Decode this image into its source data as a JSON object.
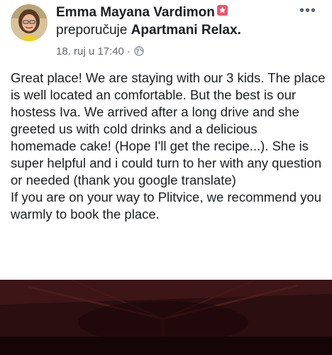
{
  "post": {
    "author": "Emma Mayana Vardimon",
    "action": "preporučuje",
    "page_name": "Apartmani Relax.",
    "date": "18. ruj u 17:40",
    "separator": "·",
    "privacy_icon": "globe-icon",
    "more_icon": "more-options-icon",
    "badge_icon": "recommendation-badge-icon",
    "text": "Great place! We are staying with our 3 kids. The place is well located an comfortable. But the best is our hostess Iva. We arrived after a long drive and she greeted us with cold drinks and a delicious homemade cake! (Hope I'll get the recipe...). She is super helpful and i could turn to her with any question or needed (thank you google translate)\nIf you are on your way to Plitvice, we recommend you warmly to book the place."
  },
  "colors": {
    "badge": "#f25268",
    "meta_text": "#65676b",
    "body_text": "#1c1e21",
    "photo_dark": "#2a0e10"
  }
}
